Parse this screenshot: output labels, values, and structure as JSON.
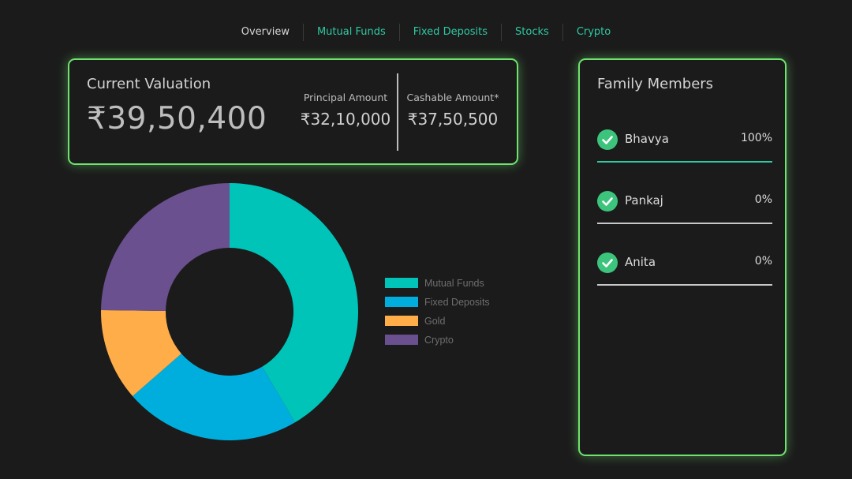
{
  "nav": {
    "items": [
      {
        "label": "Overview",
        "active": true
      },
      {
        "label": "Mutual Funds",
        "active": false
      },
      {
        "label": "Fixed Deposits",
        "active": false
      },
      {
        "label": "Stocks",
        "active": false
      },
      {
        "label": "Crypto",
        "active": false
      }
    ]
  },
  "valuation": {
    "title": "Current Valuation",
    "amount": "₹39,50,400",
    "principal_label": "Principal Amount",
    "principal_value": "₹32,10,000",
    "cashable_label": "Cashable Amount*",
    "cashable_value": "₹37,50,500"
  },
  "members": {
    "title": "Family Members",
    "items": [
      {
        "name": "Bhavya",
        "percent": "100%",
        "selected": true
      },
      {
        "name": "Pankaj",
        "percent": "0%",
        "selected": false
      },
      {
        "name": "Anita",
        "percent": "0%",
        "selected": false
      }
    ]
  },
  "colors": {
    "accent": "#2ec9a0",
    "card_border": "#6ee36e",
    "check": "#3cc47c",
    "selected_line": "#2ec9a0",
    "unselected_line": "#c8c8c8"
  },
  "chart_data": {
    "type": "pie",
    "categories": [
      "Mutual Funds",
      "Fixed Deposits",
      "Gold",
      "Crypto"
    ],
    "values": [
      41.5,
      22.1,
      11.6,
      24.8
    ],
    "colors": [
      "#00c4b8",
      "#00aedd",
      "#ffad48",
      "#6a508e"
    ],
    "legend": "right",
    "donut": true
  }
}
